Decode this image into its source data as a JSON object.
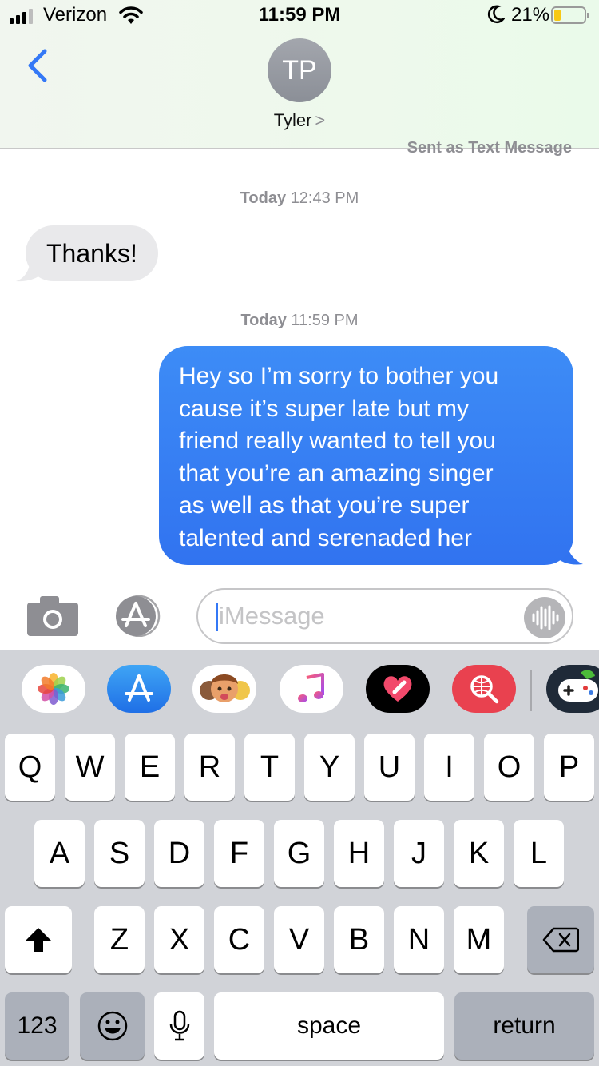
{
  "status_bar": {
    "carrier": "Verizon",
    "time": "11:59 PM",
    "battery_percent": "21%",
    "battery_level": 0.21,
    "battery_color": "#f7c815"
  },
  "header": {
    "back_icon": "chevron-left-icon",
    "avatar_initials": "TP",
    "contact_name": "Tyler",
    "contact_chevron": ">"
  },
  "thread": {
    "sent_as_label": "Sent as Text Message",
    "timestamps": [
      {
        "day": "Today",
        "time": "12:43 PM"
      },
      {
        "day": "Today",
        "time": "11:59 PM"
      }
    ],
    "messages": [
      {
        "direction": "incoming",
        "text": "Thanks!"
      },
      {
        "direction": "outgoing",
        "lines": [
          "Hey so I’m sorry to bother you",
          "cause it’s super late but my",
          "friend really wanted to tell you",
          "that you’re an amazing singer",
          "as well as that you’re super",
          "talented and serenaded her"
        ]
      }
    ],
    "incoming_color": "#e9e9eb",
    "outgoing_color": "#3478f6"
  },
  "compose": {
    "camera_icon": "camera-icon",
    "apps_icon": "app-store-icon",
    "placeholder": "iMessage",
    "audio_icon": "audio-waveform-icon"
  },
  "app_strip": [
    "photos-icon",
    "app-store-icon",
    "memoji-icon",
    "music-icon",
    "digital-touch-icon",
    "web-search-icon",
    "game-pigeon-icon"
  ],
  "keyboard": {
    "row1": [
      "Q",
      "W",
      "E",
      "R",
      "T",
      "Y",
      "U",
      "I",
      "O",
      "P"
    ],
    "row2": [
      "A",
      "S",
      "D",
      "F",
      "G",
      "H",
      "J",
      "K",
      "L"
    ],
    "row3": [
      "Z",
      "X",
      "C",
      "V",
      "B",
      "N",
      "M"
    ],
    "numbers_label": "123",
    "space_label": "space",
    "return_label": "return",
    "shift_icon": "shift-icon",
    "delete_icon": "delete-icon",
    "emoji_icon": "emoji-icon",
    "dictation_icon": "microphone-icon"
  }
}
